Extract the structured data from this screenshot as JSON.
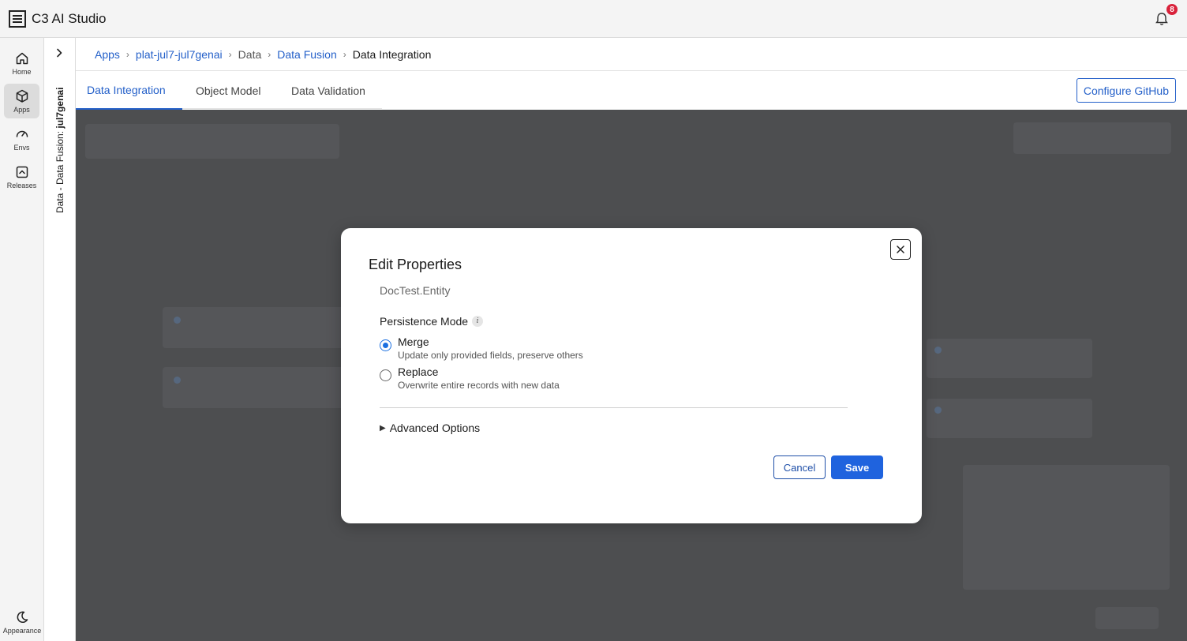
{
  "app": {
    "title": "C3 AI Studio",
    "notification_count": "8"
  },
  "rail": {
    "items": [
      {
        "label": "Home",
        "icon": "home-icon"
      },
      {
        "label": "Apps",
        "icon": "cube-icon",
        "active": true
      },
      {
        "label": "Envs",
        "icon": "gauge-icon"
      },
      {
        "label": "Releases",
        "icon": "releases-icon"
      }
    ],
    "appearance_label": "Appearance"
  },
  "subpanel": {
    "context_prefix": "Data - Data Fusion:",
    "context_name": "jul7genai"
  },
  "breadcrumb": {
    "items": [
      "Apps",
      "plat-jul7-jul7genai",
      "Data",
      "Data Fusion",
      "Data Integration"
    ]
  },
  "tabs": {
    "items": [
      "Data Integration",
      "Object Model",
      "Data Validation"
    ],
    "active": "Data Integration",
    "configure_github": "Configure GitHub"
  },
  "modal": {
    "title": "Edit Properties",
    "entity": "DocTest.Entity",
    "field_label": "Persistence Mode",
    "info_glyph": "i",
    "options": [
      {
        "title": "Merge",
        "description": "Update only provided fields, preserve others",
        "selected": true
      },
      {
        "title": "Replace",
        "description": "Overwrite entire records with new data",
        "selected": false
      }
    ],
    "advanced_label": "Advanced Options",
    "cancel_label": "Cancel",
    "save_label": "Save"
  },
  "colors": {
    "accent": "#2460c9",
    "primary_button": "#1f63de",
    "overlay": "#4d4e50",
    "badge": "#d9223b"
  }
}
